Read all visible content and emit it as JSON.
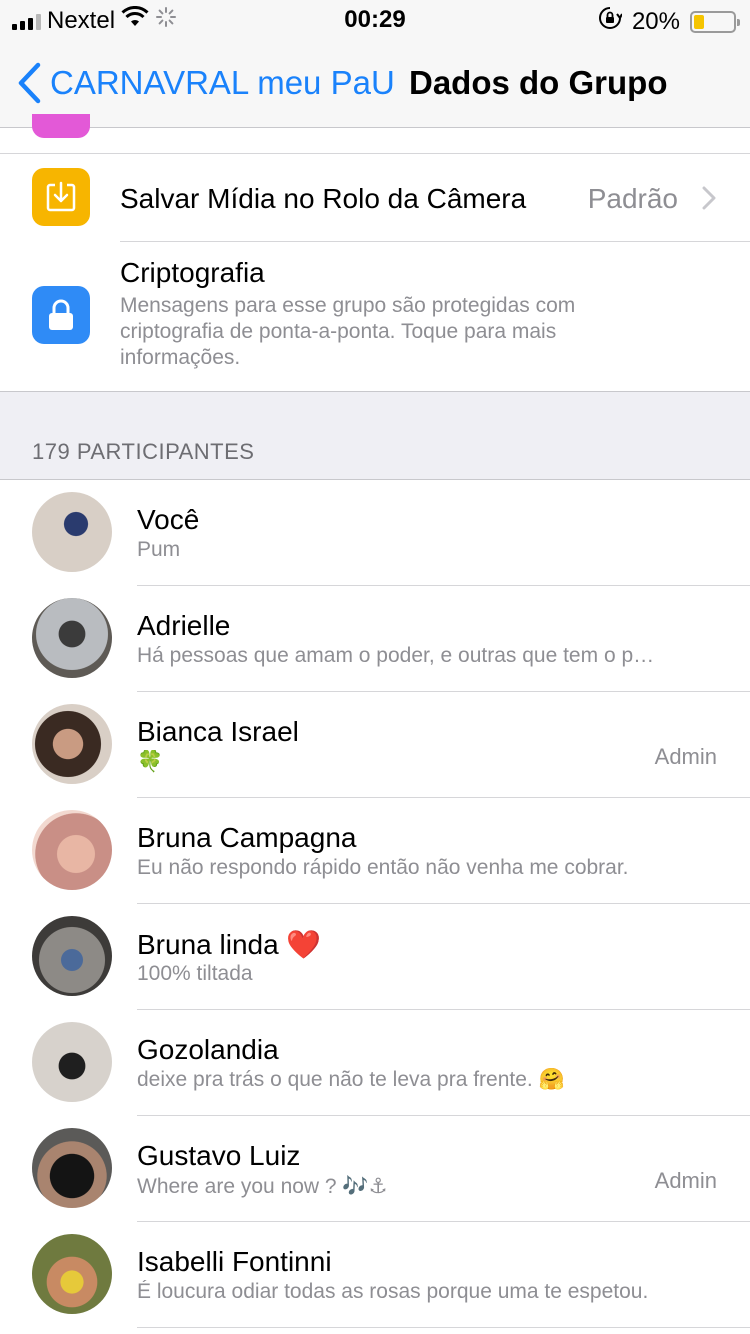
{
  "status_bar": {
    "carrier": "Nextel",
    "time": "00:29",
    "battery_percent": "20%",
    "battery_level": 0.2,
    "icons": [
      "signal-icon",
      "wifi-icon",
      "activity-spinner-icon",
      "orientation-lock-icon",
      "battery-icon"
    ]
  },
  "nav": {
    "back_label": "CARNAVRAL meu PaU",
    "title": "Dados do Grupo"
  },
  "settings": {
    "save_media": {
      "label": "Salvar Mídia no Rolo da Câmera",
      "value": "Padrão",
      "icon": "save-to-camera-roll-icon",
      "icon_color": "#f7b500"
    },
    "encryption": {
      "title": "Criptografia",
      "description": "Mensagens para esse grupo são protegidas com criptografia de ponta-a-ponta. Toque para mais informações.",
      "icon": "lock-icon",
      "icon_color": "#2f8bf6"
    }
  },
  "participants": {
    "header": "179 PARTICIPANTES",
    "admin_label": "Admin",
    "items": [
      {
        "name": "Você",
        "status": "Pum",
        "admin": false
      },
      {
        "name": "Adrielle",
        "status": "Há pessoas que amam o poder, e outras que tem o p…",
        "admin": false
      },
      {
        "name": "Bianca Israel",
        "status": "🍀",
        "admin": true
      },
      {
        "name": "Bruna Campagna",
        "status": "Eu não respondo rápido então não venha me cobrar.",
        "admin": false
      },
      {
        "name": "Bruna linda ❤️",
        "status": "100% tiltada",
        "admin": false
      },
      {
        "name": "Gozolandia",
        "status": "deixe pra trás o que não te leva pra frente. 🤗",
        "admin": false
      },
      {
        "name": "Gustavo Luiz",
        "status": "Where are you now ? 🎶⚓",
        "admin": true
      },
      {
        "name": "Isabelli Fontinni",
        "status": "É loucura odiar todas as rosas porque uma te espetou.",
        "admin": false
      }
    ]
  },
  "colors": {
    "accent": "#1a82fb",
    "secondary_text": "#8e8e93",
    "section_bg": "#efeff4"
  }
}
